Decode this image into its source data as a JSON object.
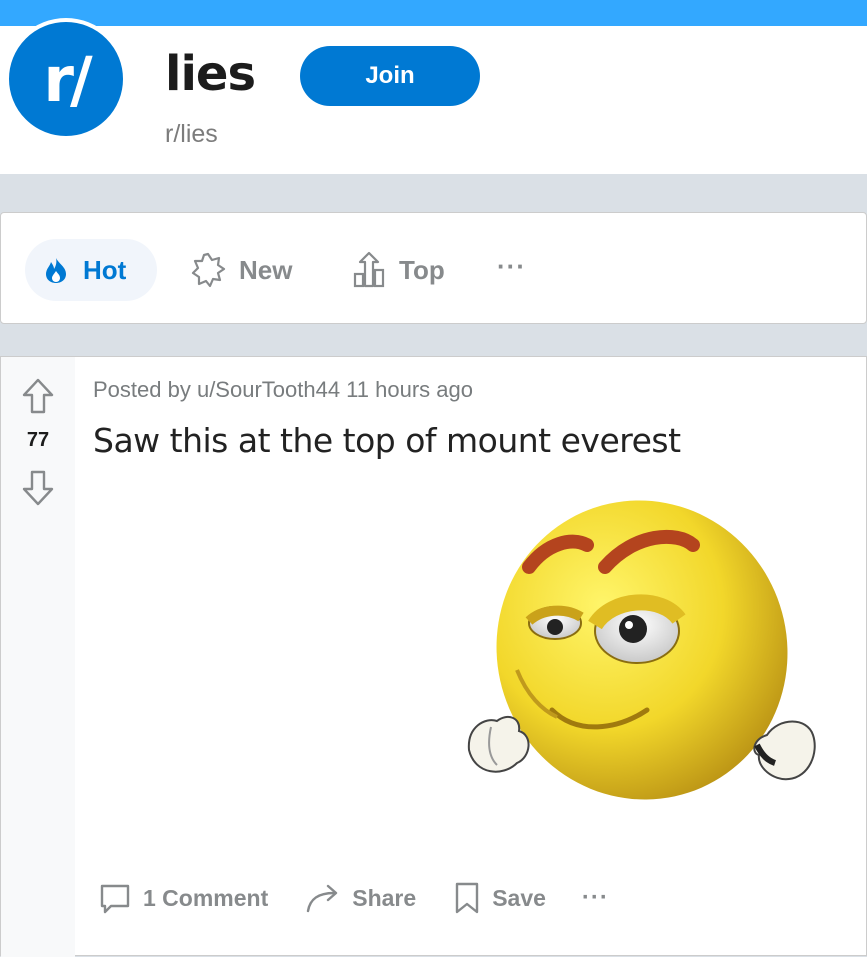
{
  "subreddit": {
    "icon_text": "r/",
    "name": "lies",
    "slug": "r/lies",
    "join_label": "Join",
    "brand_color": "#0079d3"
  },
  "sort": {
    "items": [
      {
        "label": "Hot",
        "icon": "flame-icon",
        "active": true
      },
      {
        "label": "New",
        "icon": "burst-icon",
        "active": false
      },
      {
        "label": "Top",
        "icon": "rising-bars-icon",
        "active": false
      }
    ],
    "more_label": "···"
  },
  "post": {
    "votes": "77",
    "meta": "Posted by u/SourTooth44 11 hours ago",
    "title": "Saw this at the top of mount everest",
    "image_icon": "smug-emoji",
    "actions": {
      "comment_label": "1 Comment",
      "share_label": "Share",
      "save_label": "Save",
      "more_label": "···"
    }
  }
}
